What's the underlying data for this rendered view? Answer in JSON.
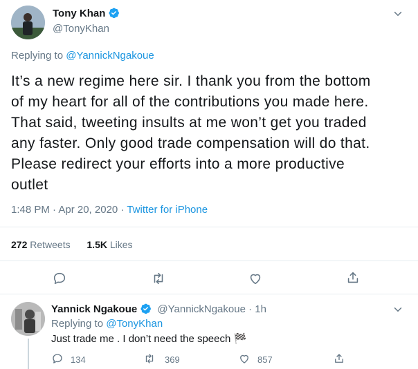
{
  "main_tweet": {
    "author_name": "Tony Khan",
    "author_handle": "@TonyKhan",
    "replying_prefix": "Replying to",
    "replying_to": "@YannickNgakoue",
    "text_lines": [
      "It’s a new regime here sir. I thank you from the bottom",
      "of my heart for all of the contributions you made here.",
      "That said, tweeting insults at me won’t get you traded",
      "any faster. Only good trade compensation will do that.",
      "Please redirect your efforts into a more productive",
      "outlet"
    ],
    "timestamp": "1:48 PM · Apr 20, 2020",
    "separator": "·",
    "source": "Twitter for iPhone",
    "retweets_count": "272",
    "retweets_label": "Retweets",
    "likes_count": "1.5K",
    "likes_label": "Likes"
  },
  "reply_tweet": {
    "author_name": "Yannick Ngakoue",
    "author_handle": "@YannickNgakoue",
    "time": "· 1h",
    "replying_prefix": "Replying to",
    "replying_to": "@TonyKhan",
    "text": "Just trade me . I don’t need the speech",
    "emoji": "🏁",
    "reply_count": "134",
    "retweet_count": "369",
    "like_count": "857"
  },
  "colors": {
    "accent": "#1b95e0",
    "muted": "#657786",
    "text": "#14171a",
    "border": "#e6ecf0"
  }
}
